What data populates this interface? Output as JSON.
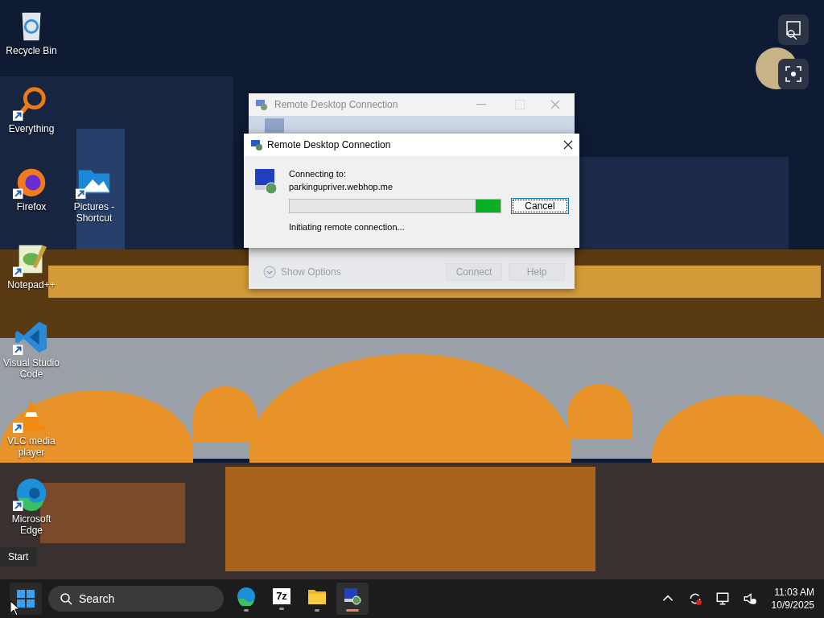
{
  "desktop_icons": [
    {
      "label": "Recycle Bin",
      "kind": "recycle",
      "shortcut": false
    },
    {
      "label": "Everything",
      "kind": "everything",
      "shortcut": true
    },
    {
      "label": "Firefox",
      "kind": "firefox",
      "shortcut": true
    },
    {
      "label": "Pictures - Shortcut",
      "kind": "pictures",
      "shortcut": true
    },
    {
      "label": "Notepad++",
      "kind": "notepad",
      "shortcut": true
    },
    {
      "label": "Visual Studio Code",
      "kind": "vscode",
      "shortcut": true
    },
    {
      "label": "VLC media player",
      "kind": "vlc",
      "shortcut": true
    },
    {
      "label": "Microsoft Edge",
      "kind": "edge",
      "shortcut": true
    }
  ],
  "tooltip": "Start",
  "back_window": {
    "title": "Remote Desktop Connection",
    "show_options": "Show Options",
    "buttons": [
      "Connect",
      "Help"
    ]
  },
  "dialog": {
    "title": "Remote Desktop Connection",
    "label": "Connecting to:",
    "host": "parkingupriver.webhop.me",
    "progress": {
      "level": 0.12
    },
    "status": "Initiating remote connection...",
    "button": "Cancel"
  },
  "taskbar": {
    "search": {
      "placeholder": "Search"
    },
    "apps": [
      {
        "kind": "edge",
        "selected": false
      },
      {
        "kind": "archive",
        "label": "7z",
        "selected": false
      },
      {
        "kind": "explorer",
        "selected": false
      },
      {
        "kind": "rdp",
        "selected": true
      }
    ],
    "clock": {
      "time": "11:03 AM",
      "date": "10/9/2025"
    }
  }
}
